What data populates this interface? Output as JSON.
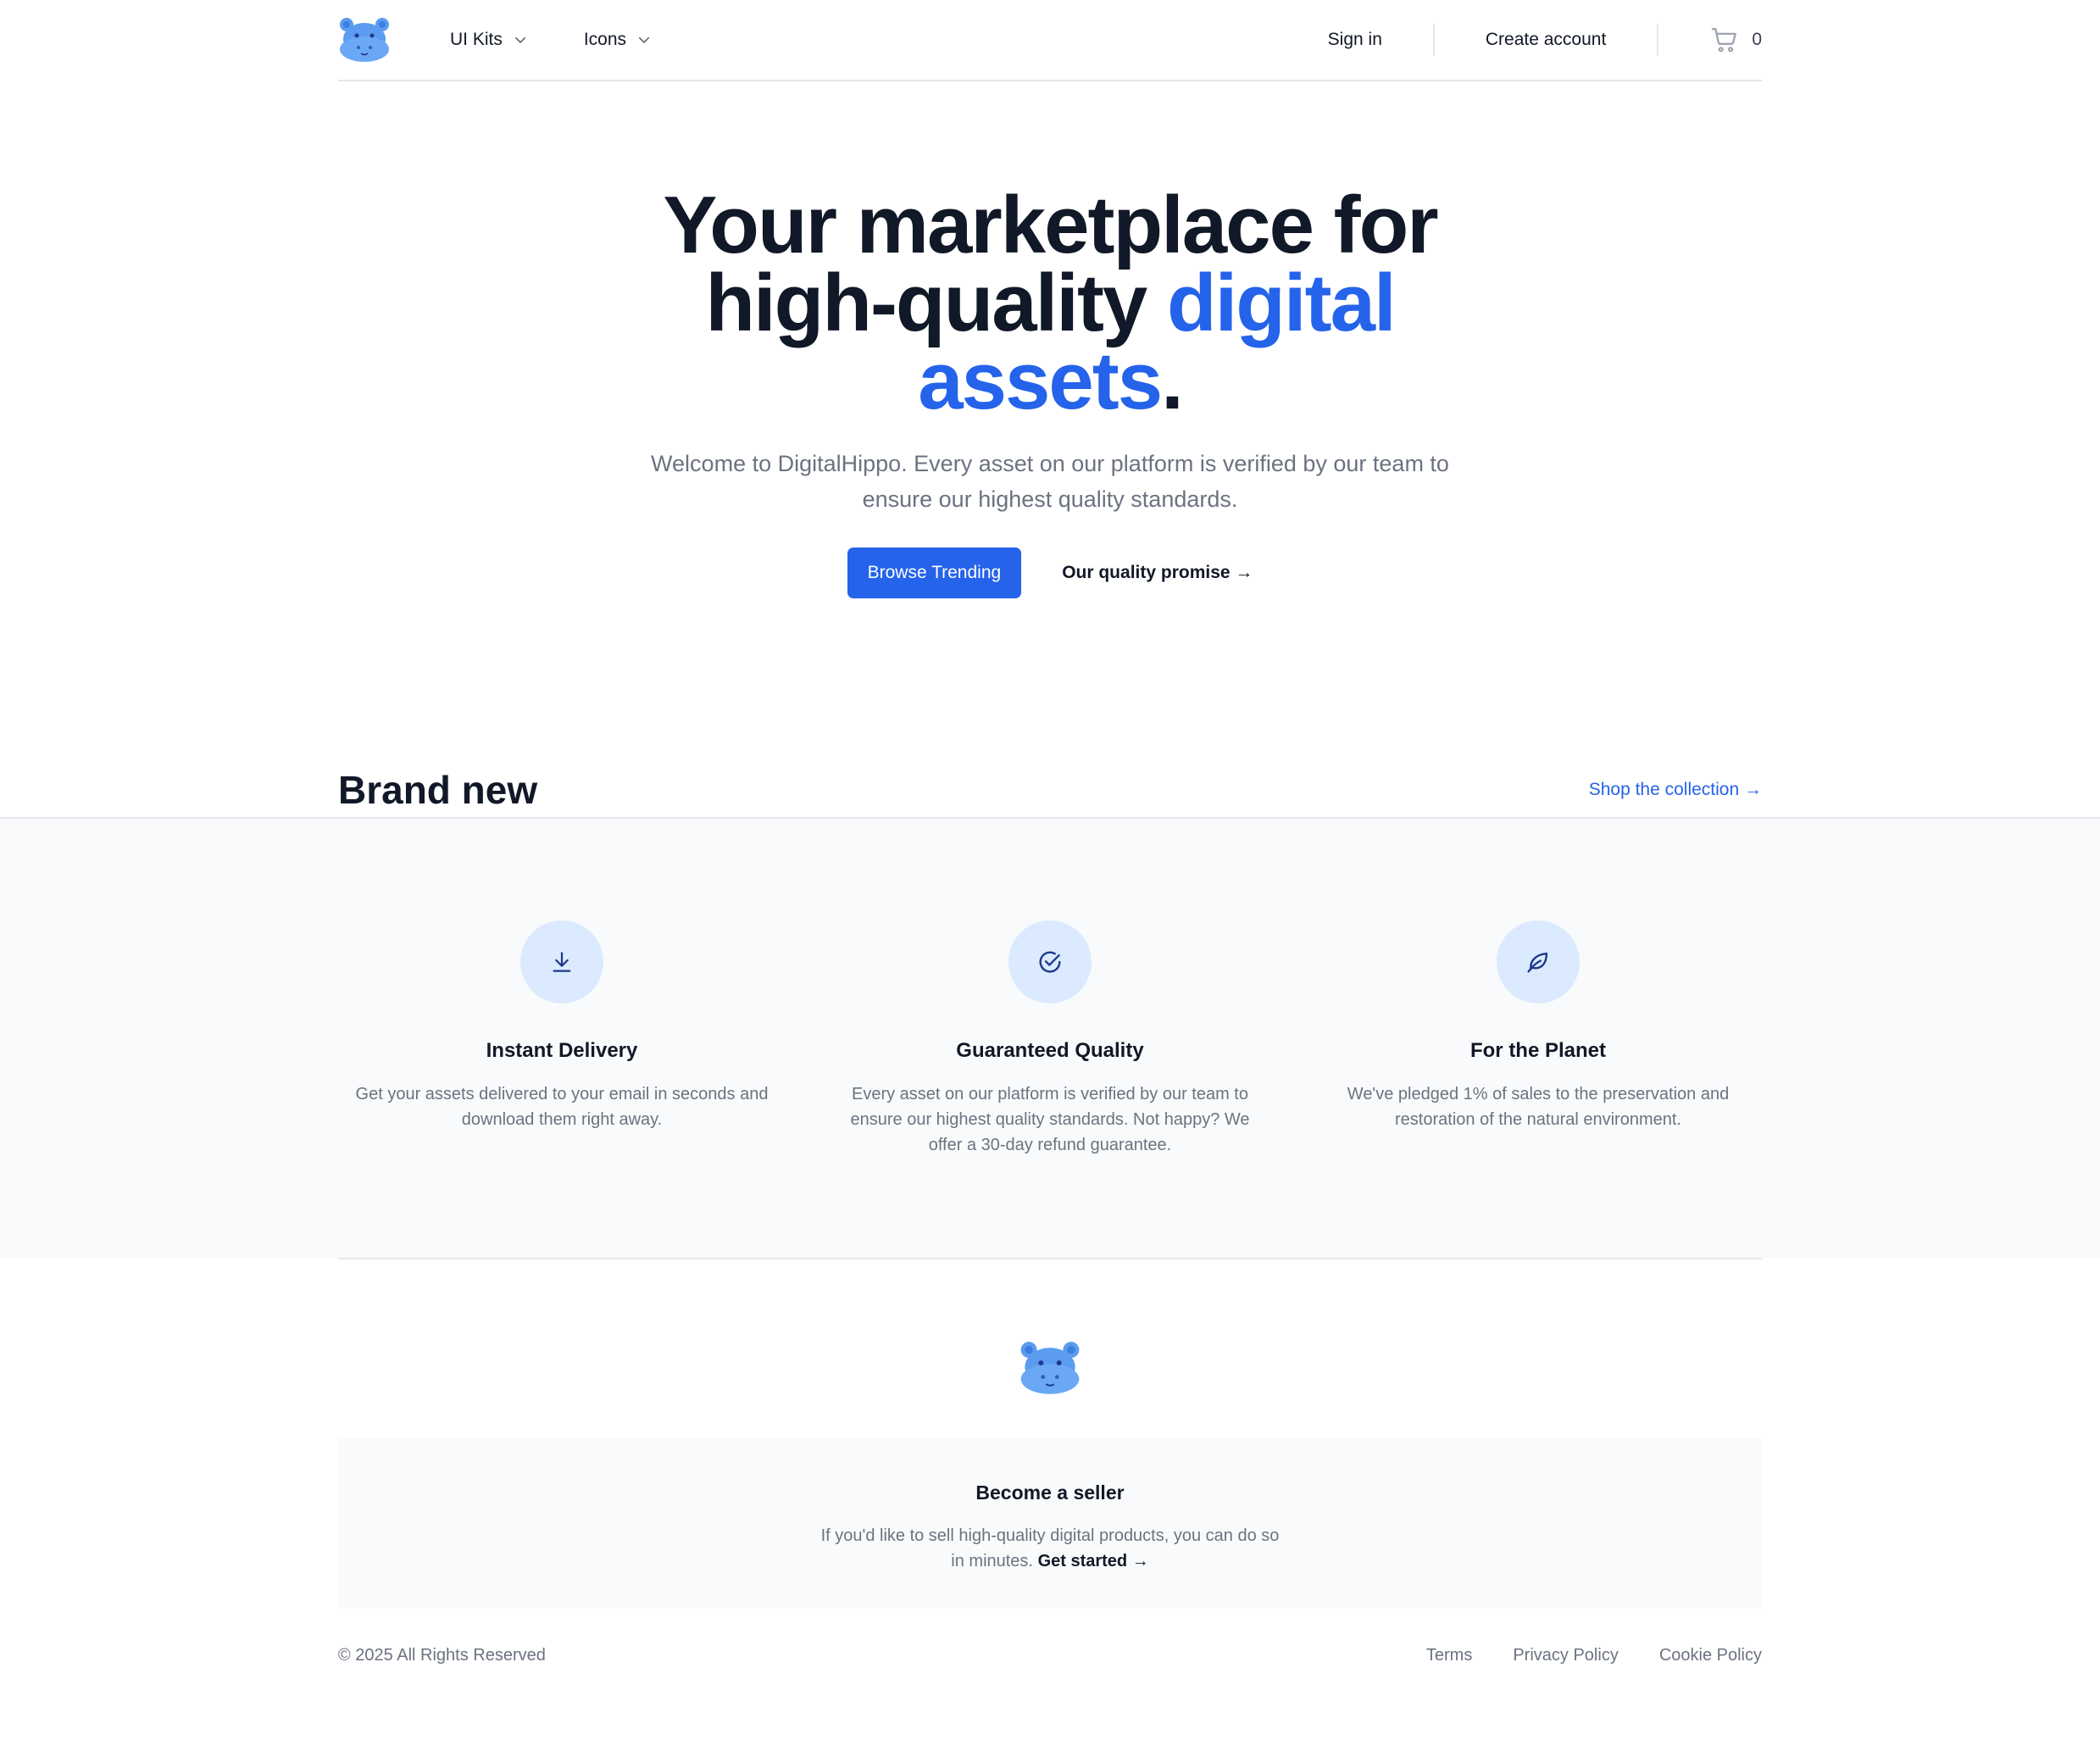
{
  "colors": {
    "accent": "#2563eb",
    "perk_icon_bg": "#dbeafe",
    "band_bg": "#f9fafb",
    "logo_blue": "#5b9bf0"
  },
  "navbar": {
    "logo_icon": "hippo-logo-icon",
    "menu": [
      {
        "label": "UI Kits",
        "icon": "chevron-down-icon"
      },
      {
        "label": "Icons",
        "icon": "chevron-down-icon"
      }
    ],
    "sign_in": "Sign in",
    "create_account": "Create account",
    "cart_icon": "shopping-cart-icon",
    "cart_count": "0"
  },
  "hero": {
    "title_part1": "Your marketplace for high-quality ",
    "title_accent": "digital assets",
    "title_end": ".",
    "subtitle": "Welcome to DigitalHippo. Every asset on our platform is verified by our team to ensure our highest quality standards.",
    "primary_button": "Browse Trending",
    "secondary_button": "Our quality promise →"
  },
  "brand_new": {
    "title": "Brand new",
    "link": "Shop the collection →"
  },
  "perks": [
    {
      "icon": "download-icon",
      "title": "Instant Delivery",
      "text": "Get your assets delivered to your email in seconds and download them right away."
    },
    {
      "icon": "check-circle-icon",
      "title": "Guaranteed Quality",
      "text": "Every asset on our platform is verified by our team to ensure our highest quality standards. Not happy? We offer a 30-day refund guarantee."
    },
    {
      "icon": "leaf-icon",
      "title": "For the Planet",
      "text": "We've pledged 1% of sales to the preservation and restoration of the natural environment."
    }
  ],
  "footer": {
    "logo_icon": "hippo-logo-icon",
    "seller_title": "Become a seller",
    "seller_text": "If you'd like to sell high-quality digital products, you can do so in minutes.",
    "seller_link": "Get started →",
    "copyright": "© 2025 All Rights Reserved",
    "links": [
      "Terms",
      "Privacy Policy",
      "Cookie Policy"
    ]
  }
}
